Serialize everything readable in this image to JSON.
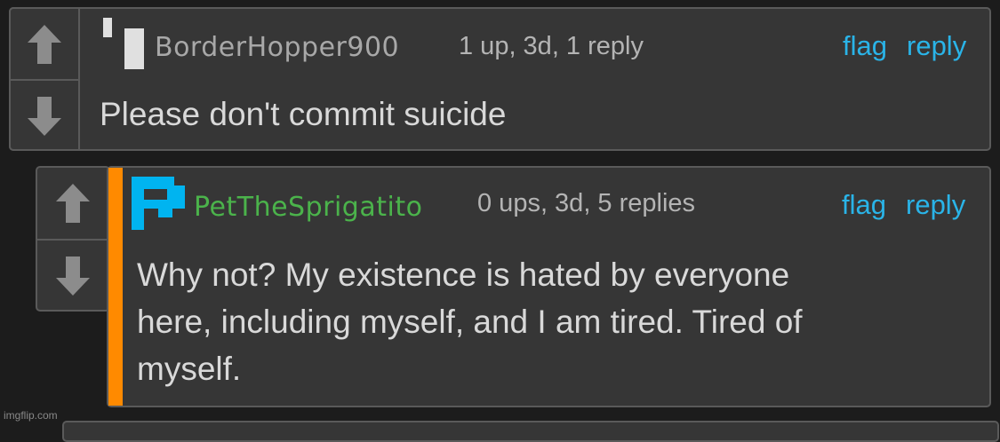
{
  "comments": [
    {
      "username": "BorderHopper900",
      "meta": "1 up, 3d, 1 reply",
      "flag": "flag",
      "reply": "reply",
      "text": "Please don't commit suicide"
    },
    {
      "username": "PetTheSprigatito",
      "meta": "0 ups, 3d, 5 replies",
      "flag": "flag",
      "reply": "reply",
      "text_lines": [
        "Why not? My existence is hated by everyone",
        "here, including myself, and I am tired. Tired of",
        "myself."
      ]
    }
  ],
  "watermark": "imgflip.com",
  "colors": {
    "background": "#1c1c1c",
    "card": "#363636",
    "border": "#5a5a5a",
    "link": "#2ab4e8",
    "username_green": "#4bb34b",
    "reply_bar": "#ff8a00",
    "avatar_blue": "#00b4f0"
  },
  "icons": [
    "upvote-arrow-icon",
    "downvote-arrow-icon",
    "user-avatar-icon"
  ]
}
